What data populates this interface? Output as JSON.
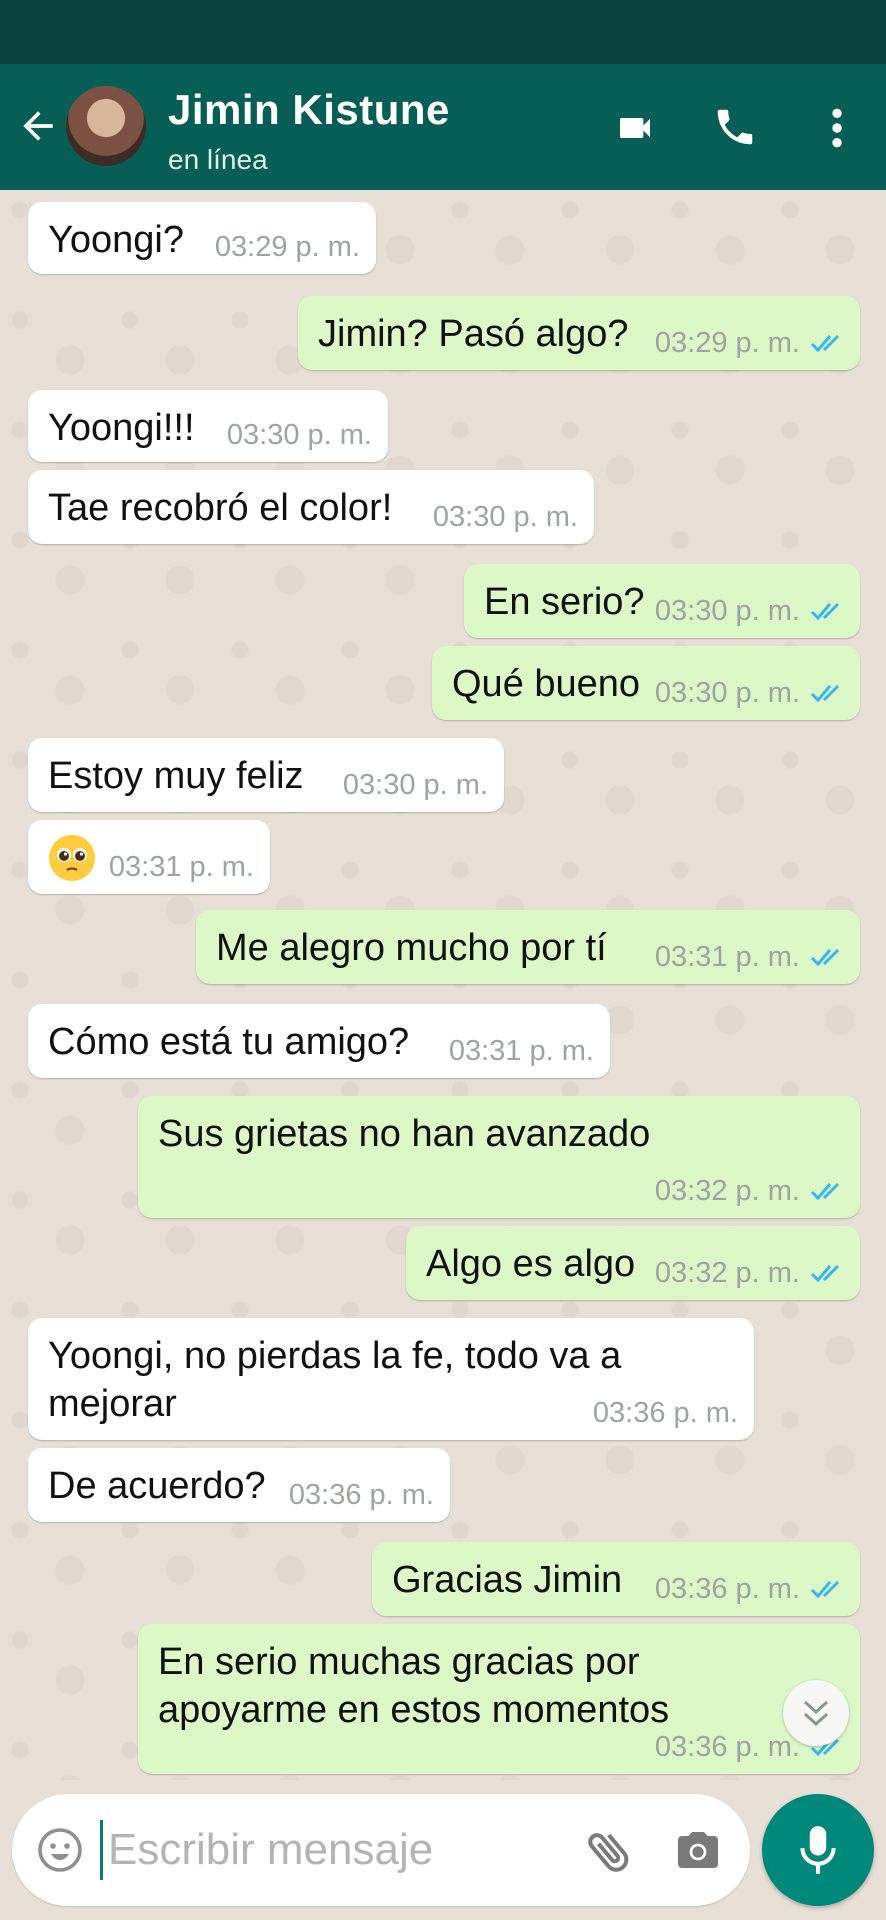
{
  "header": {
    "contact_name": "Jimin Kistune",
    "status": "en línea"
  },
  "messages": [
    {
      "dir": "in",
      "text": "Yoongi?",
      "time": "03:29 p. m."
    },
    {
      "dir": "out",
      "text": "Jimin? Pasó algo?",
      "time": "03:29 p. m.",
      "read": true
    },
    {
      "dir": "in",
      "text": "Yoongi!!!",
      "time": "03:30 p. m."
    },
    {
      "dir": "in",
      "text": "Tae recobró el color!",
      "time": "03:30 p. m."
    },
    {
      "dir": "out",
      "text": "En serio?",
      "time": "03:30 p. m.",
      "read": true
    },
    {
      "dir": "out",
      "text": "Qué bueno",
      "time": "03:30 p. m.",
      "read": true
    },
    {
      "dir": "in",
      "text": "Estoy muy feliz",
      "time": "03:30 p. m."
    },
    {
      "dir": "in",
      "text": "",
      "emoji": "pleading-face",
      "time": "03:31 p. m."
    },
    {
      "dir": "out",
      "text": "Me alegro mucho por tí",
      "time": "03:31 p. m.",
      "read": true
    },
    {
      "dir": "in",
      "text": "Cómo está tu amigo?",
      "time": "03:31 p. m."
    },
    {
      "dir": "out",
      "text": "Sus grietas no han avanzado",
      "time": "03:32 p. m.",
      "read": true
    },
    {
      "dir": "out",
      "text": "Algo es algo",
      "time": "03:32 p. m.",
      "read": true
    },
    {
      "dir": "in",
      "text_line1": "Yoongi, no pierdas la fe, todo va a",
      "text_line2": "mejorar",
      "time": "03:36 p. m."
    },
    {
      "dir": "in",
      "text": "De acuerdo?",
      "time": "03:36 p. m."
    },
    {
      "dir": "out",
      "text": "Gracias Jimin",
      "time": "03:36 p. m.",
      "read": true
    },
    {
      "dir": "out",
      "text_line1": "En serio muchas gracias por",
      "text_line2": "apoyarme en estos momentos",
      "time": "03:36 p. m.",
      "read": true
    }
  ],
  "composer": {
    "placeholder": "Escribir mensaje"
  },
  "colors": {
    "header_bg": "#075e54",
    "status_bar": "#0b443e",
    "outgoing_bubble": "#dcf8c6",
    "incoming_bubble": "#ffffff",
    "read_ticks": "#34b7f1",
    "mic_button": "#00897b"
  },
  "icons": [
    "back-arrow-icon",
    "video-call-icon",
    "phone-icon",
    "more-vert-icon",
    "emoji-icon",
    "attach-icon",
    "camera-icon",
    "mic-icon",
    "double-chevron-down-icon",
    "read-double-check-icon"
  ]
}
